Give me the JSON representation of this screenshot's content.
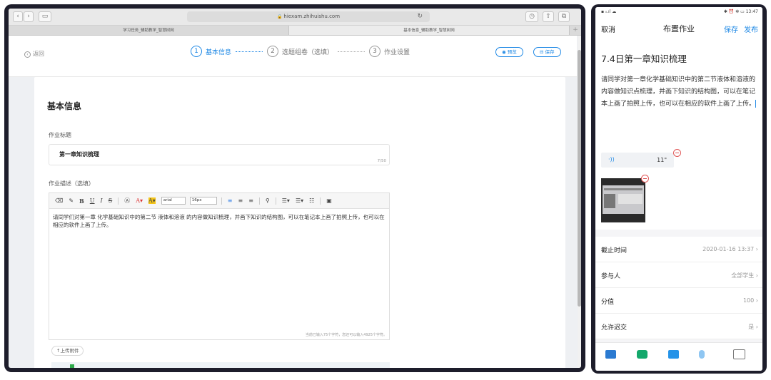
{
  "browser": {
    "url": "hiexam.zhihuishu.com",
    "tabs": [
      "学习任务_辅助教学_智慧树网",
      "基本信息_辅助教学_智慧树网"
    ],
    "active_tab": 1
  },
  "header": {
    "back_label": "返回",
    "steps": [
      {
        "num": "1",
        "label": "基本信息"
      },
      {
        "num": "2",
        "label": "选题组卷（选填）"
      },
      {
        "num": "3",
        "label": "作业设置"
      }
    ],
    "preview_label": "预览",
    "save_label": "保存"
  },
  "form": {
    "section_title": "基本信息",
    "title_label": "作业标题",
    "title_value": "第一章知识梳理",
    "title_count": "7/50",
    "desc_label": "作业描述（选填）",
    "toolbar": {
      "font": "arial",
      "size": "16px"
    },
    "desc_text": "请同学们对第一章 化学基础知识中的第二节 液体和溶液 的内容做知识梳理，并画下知识的结构图，可以在笔记本上画了拍照上传，也可以在相应的软件上画了上传。",
    "desc_count": "当前已输入75个字符，您还可以输入4925个字符。",
    "upload_label": "上传附件"
  },
  "mobile": {
    "status_left": "▪ ᵢₗ.ıl ☁",
    "status_right": "✱ ⏰ ✻ ▭ 13:47",
    "nav": {
      "cancel": "取消",
      "title": "布置作业",
      "save": "保存",
      "publish": "发布"
    },
    "title": "7.4日第一章知识梳理",
    "desc": "请同学对第一章化学基础知识中的第二节液体和溶液的内容做知识点梳理，并画下知识的结构图，可以在笔记本上画了拍照上传，也可以在相应的软件上画了上传。",
    "audio_duration": "11\"",
    "rows": [
      {
        "key": "截止时间",
        "value": "2020-01-16 13:37"
      },
      {
        "key": "参与人",
        "value": "全部学生"
      },
      {
        "key": "分值",
        "value": "100"
      },
      {
        "key": "允许迟交",
        "value": "是"
      }
    ]
  },
  "colors": {
    "accent": "#1e88e5",
    "danger": "#e05555",
    "frame": "#1d1d2b"
  }
}
